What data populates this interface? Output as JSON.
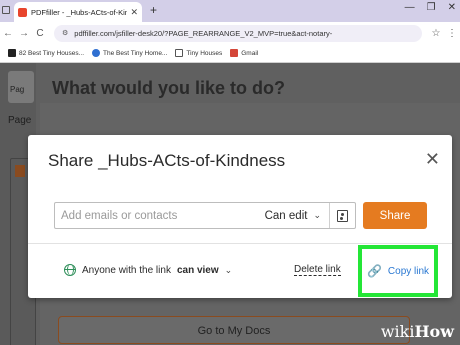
{
  "browser": {
    "tab_title": "PDFfiller - _Hubs-ACts-of-Kindn",
    "tab_close": "✕",
    "new_tab": "+",
    "window_controls": [
      "—",
      "❐",
      "✕"
    ],
    "nav": {
      "back": "←",
      "forward": "→",
      "reload": "C"
    },
    "url": "pdffiller.com/jsfiller-desk20/?PAGE_REARRANGE_V2_MVP=true&act-notary-",
    "star": "☆",
    "menu": "⋮"
  },
  "bookmarks": [
    {
      "label": "82 Best Tiny Houses..."
    },
    {
      "label": "The Best Tiny Home..."
    },
    {
      "label": "Tiny Houses"
    },
    {
      "label": "Gmail"
    }
  ],
  "background_page": {
    "heading": "What would you like to do?",
    "sidebar_card_label": "Pag",
    "sidebar_label": "Page",
    "button_label": "Go to My Docs"
  },
  "share_dialog": {
    "title": "Share _Hubs-ACts-of-Kindness",
    "close": "✕",
    "invite_placeholder": "Add emails or contacts",
    "permission": "Can edit",
    "permission_chevron": "⌄",
    "share_button": "Share",
    "link_access_prefix": "Anyone with the link",
    "link_access_level": "can view",
    "link_access_chevron": "⌄",
    "delete_link": "Delete link",
    "copy_link": "Copy link",
    "copy_link_icon": "link-icon"
  },
  "watermark": {
    "part1": "wiki",
    "part2": "How"
  },
  "colors": {
    "accent_orange": "#e57b20",
    "link_blue": "#2a78d2",
    "highlight_green": "#24e636",
    "globe_green": "#2f8f5a"
  }
}
